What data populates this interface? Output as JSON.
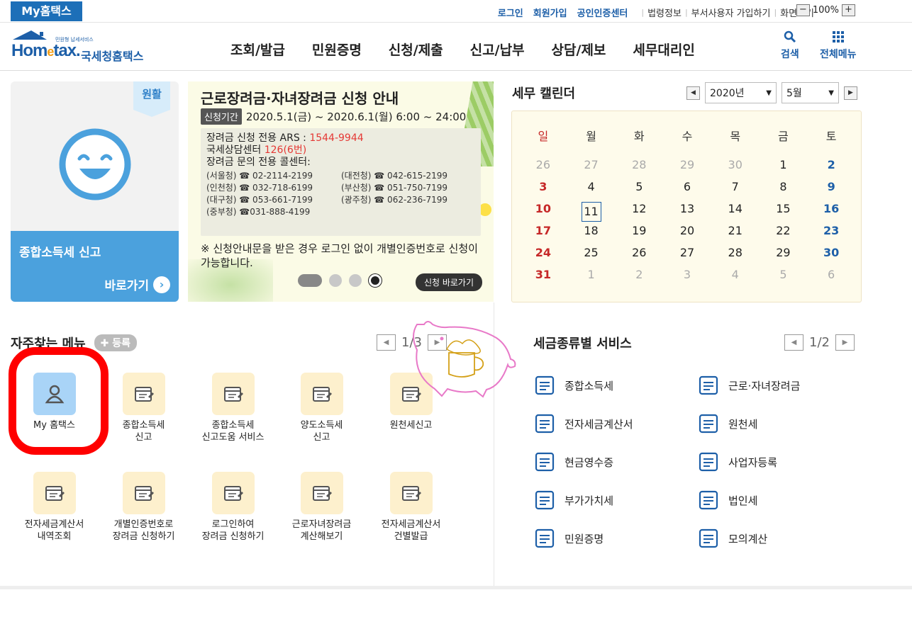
{
  "topbar": {
    "my_hometax": "My홈택스",
    "links": [
      "로그인",
      "회원가입",
      "공인인증센터"
    ],
    "util_links": [
      "법령정보",
      "부서사용자 가입하기",
      "화면크기"
    ],
    "zoom_minus": "−",
    "zoom_value": "100%",
    "zoom_plus": "+"
  },
  "header": {
    "logo_word_a": "Hom",
    "logo_word_e": "e",
    "logo_word_b": "tax.",
    "logo_kr": "국세청홈택스",
    "logo_tiny": "민원형 납세서비스",
    "nav": [
      "조회/발급",
      "민원증명",
      "신청/제출",
      "신고/납부",
      "상담/제보",
      "세무대리인"
    ],
    "search_label": "검색",
    "menu_label": "전체메뉴"
  },
  "promo": {
    "badge": "원활",
    "title": "종합소득세 신고",
    "go": "바로가기"
  },
  "banner": {
    "title": "근로장려금·자녀장려금 신청 안내",
    "period_tag": "신청기간",
    "period": "2020.5.1(금) ~ 2020.6.1(월) 6:00 ~ 24:00",
    "ars_label": "장려금 신청 전용 ARS : ",
    "ars_num": "1544-9944",
    "center_label": "국세상담센터 ",
    "center_num": "126(6번)",
    "callcenter": "장려금 문의 전용 콜센터:",
    "phones": [
      "(서울청) ☎ 02-2114-2199",
      "(대전청) ☎ 042-615-2199",
      "(인천청) ☎ 032-718-6199",
      "(부산청) ☎ 051-750-7199",
      "(대구청) ☎ 053-661-7199",
      "(광주청) ☎ 062-236-7199",
      "(중부청) ☎031-888-4199"
    ],
    "note": "※ 신청안내문을 받은 경우 로그인 없이 개별인증번호로 신청이 가능합니다.",
    "button": "신청 바로가기"
  },
  "calendar": {
    "title": "세무 캘린더",
    "year": "2020년",
    "month": "5월",
    "weekdays": [
      "일",
      "월",
      "화",
      "수",
      "목",
      "금",
      "토"
    ],
    "weeks": [
      [
        "26",
        "27",
        "28",
        "29",
        "30",
        "1",
        "2"
      ],
      [
        "3",
        "4",
        "5",
        "6",
        "7",
        "8",
        "9"
      ],
      [
        "10",
        "11",
        "12",
        "13",
        "14",
        "15",
        "16"
      ],
      [
        "17",
        "18",
        "19",
        "20",
        "21",
        "22",
        "23"
      ],
      [
        "24",
        "25",
        "26",
        "27",
        "28",
        "29",
        "30"
      ],
      [
        "31",
        "1",
        "2",
        "3",
        "4",
        "5",
        "6"
      ]
    ],
    "today": "11"
  },
  "favorites": {
    "title": "자주찾는 메뉴",
    "register": "등록",
    "page": "1/3",
    "items": [
      {
        "l1": "My 홈택스",
        "l2": ""
      },
      {
        "l1": "종합소득세",
        "l2": "신고"
      },
      {
        "l1": "종합소득세",
        "l2": "신고도움 서비스"
      },
      {
        "l1": "양도소득세",
        "l2": "신고"
      },
      {
        "l1": "원천세신고",
        "l2": ""
      },
      {
        "l1": "전자세금계산서",
        "l2": "내역조회"
      },
      {
        "l1": "개별인증번호로",
        "l2": "장려금 신청하기"
      },
      {
        "l1": "로그인하여",
        "l2": "장려금 신청하기"
      },
      {
        "l1": "근로자녀장려금",
        "l2": "계산해보기"
      },
      {
        "l1": "전자세금계산서",
        "l2": "건별발급"
      }
    ]
  },
  "services": {
    "title": "세금종류별 서비스",
    "page": "1/2",
    "items": [
      "종합소득세",
      "근로·자녀장려금",
      "전자세금계산서",
      "원천세",
      "현금영수증",
      "사업자등록",
      "부가가치세",
      "법인세",
      "민원증명",
      "모의계산"
    ]
  },
  "colors": {
    "brand": "#1d6fb8",
    "accent": "#4ba1dd",
    "sunday": "#c62828",
    "saturday": "#1d5fa8",
    "annotation": "#ff0000"
  }
}
